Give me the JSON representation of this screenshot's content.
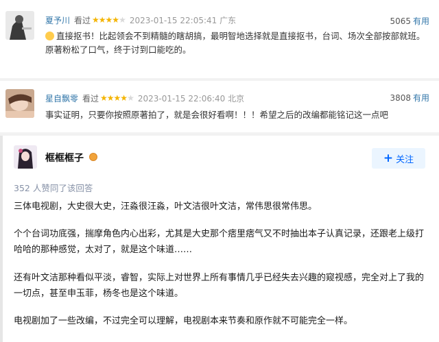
{
  "comments": [
    {
      "user": "夏予川",
      "watched": "看过",
      "stars": "★★★★",
      "stars_off": "★",
      "time": "2023-01-15 22:05:41 广东",
      "useful_count": "5065",
      "useful_label": "有用",
      "text": "直接抠书！比起领会不到精髓的瞎胡搞，最明智地选择就是直接抠书，台词、场次全部按部就班。原著粉松了口气，终于讨到口能吃的。"
    },
    {
      "user": "星自飘零",
      "watched": "看过",
      "stars": "★★★★",
      "stars_off": "★",
      "time": "2023-01-15 22:06:40 北京",
      "useful_count": "3808",
      "useful_label": "有用",
      "text": "事实证明，只要你按照原著拍了，就是会很好看啊！！！希望之后的改编都能铭记这一点吧"
    }
  ],
  "answer": {
    "author": "框框框子",
    "follow_label": "关注",
    "upvotes": "352 人赞同了该回答",
    "paragraphs": [
      "三体电视剧，大史很大史，汪淼很汪淼，叶文洁很叶文洁，常伟思很常伟思。",
      "个个台词功底强，揣摩角色内心出彩，尤其是大史那个痞里痞气又不时抽出本子认真记录，还跟老上级打哈哈的那种感觉，太对了，就是这个味道……",
      "还有叶文洁那种看似平淡，睿智，实际上对世界上所有事情几乎已经失去兴趣的窥视感，完全对上了我的一切点，甚至申玉菲，杨冬也是这个味道。",
      "电视剧加了一些改编，不过完全可以理解，电视剧本来节奏和原作就不可能完全一样。"
    ]
  }
}
